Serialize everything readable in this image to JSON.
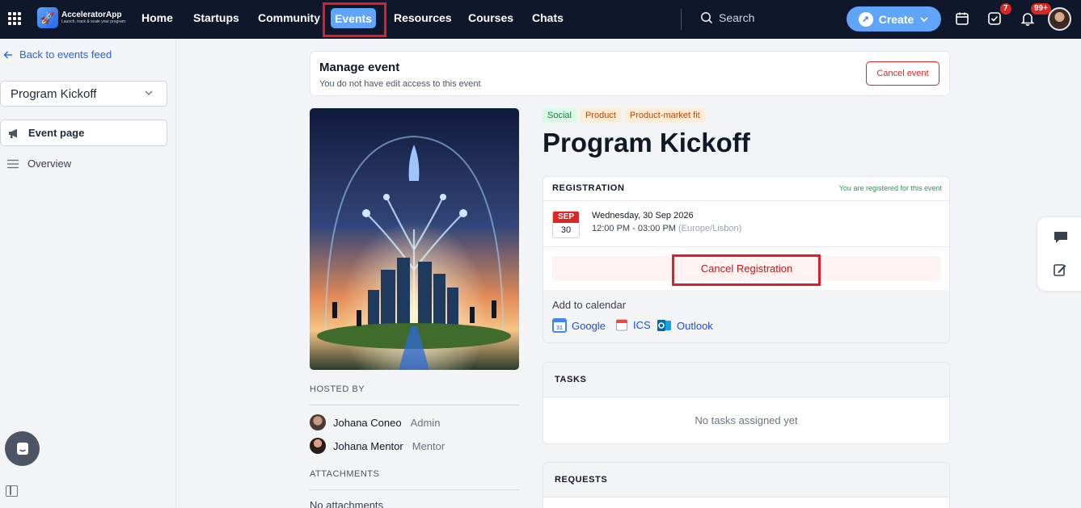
{
  "nav": {
    "brand_name": "AcceleratorApp",
    "brand_tagline": "Launch, track & scale your program",
    "items": [
      {
        "label": "Home"
      },
      {
        "label": "Startups"
      },
      {
        "label": "Community"
      },
      {
        "label": "Events"
      },
      {
        "label": "Resources"
      },
      {
        "label": "Courses"
      },
      {
        "label": "Chats"
      }
    ],
    "search_label": "Search",
    "create_label": "Create",
    "tasks_badge": "7",
    "notifications_badge": "99+",
    "icons": [
      "apps-grid-icon",
      "search-icon",
      "calendar-icon",
      "checkbox-icon",
      "bell-icon"
    ]
  },
  "sidebar": {
    "back_label": "Back to events feed",
    "event_select_value": "Program Kickoff",
    "items": [
      {
        "label": "Event page",
        "icon": "megaphone-icon"
      },
      {
        "label": "Overview",
        "icon": "menu-lines-icon"
      }
    ]
  },
  "manage": {
    "title": "Manage event",
    "subtitle": "You do not have edit access to this event",
    "cancel_event_label": "Cancel event"
  },
  "event": {
    "title": "Program Kickoff",
    "tags": [
      {
        "label": "Social",
        "bg": "#dcfce7",
        "color": "#15803d"
      },
      {
        "label": "Product",
        "bg": "#ffedd5",
        "color": "#c2410c"
      },
      {
        "label": "Product-market fit",
        "bg": "#ffedd5",
        "color": "#c2410c"
      }
    ]
  },
  "registration": {
    "label": "REGISTRATION",
    "status": "You are registered for this event",
    "cal_month": "SEP",
    "cal_day": "30",
    "date": "Wednesday, 30 Sep 2026",
    "time": "12:00 PM - 03:00 PM",
    "timezone": "(Europe/Lisbon)",
    "cancel_label": "Cancel Registration",
    "add_calendar_label": "Add to calendar",
    "calendar_links": [
      {
        "label": "Google",
        "icon": "google-calendar-icon"
      },
      {
        "label": "ICS",
        "icon": "ics-calendar-icon"
      },
      {
        "label": "Outlook",
        "icon": "outlook-icon"
      }
    ]
  },
  "hosts": {
    "label": "HOSTED BY",
    "items": [
      {
        "name": "Johana Coneo",
        "role": "Admin"
      },
      {
        "name": "Johana Mentor",
        "role": "Mentor"
      }
    ]
  },
  "attachments": {
    "label": "ATTACHMENTS",
    "empty": "No attachments"
  },
  "tasks": {
    "label": "TASKS",
    "empty": "No tasks assigned yet"
  },
  "requests": {
    "label": "REQUESTS"
  },
  "colors": {
    "nav_bg": "#0f172a",
    "accent": "#60a5fa",
    "highlight": "#e11d2a",
    "danger": "#dc2626",
    "success": "#16a34a"
  }
}
